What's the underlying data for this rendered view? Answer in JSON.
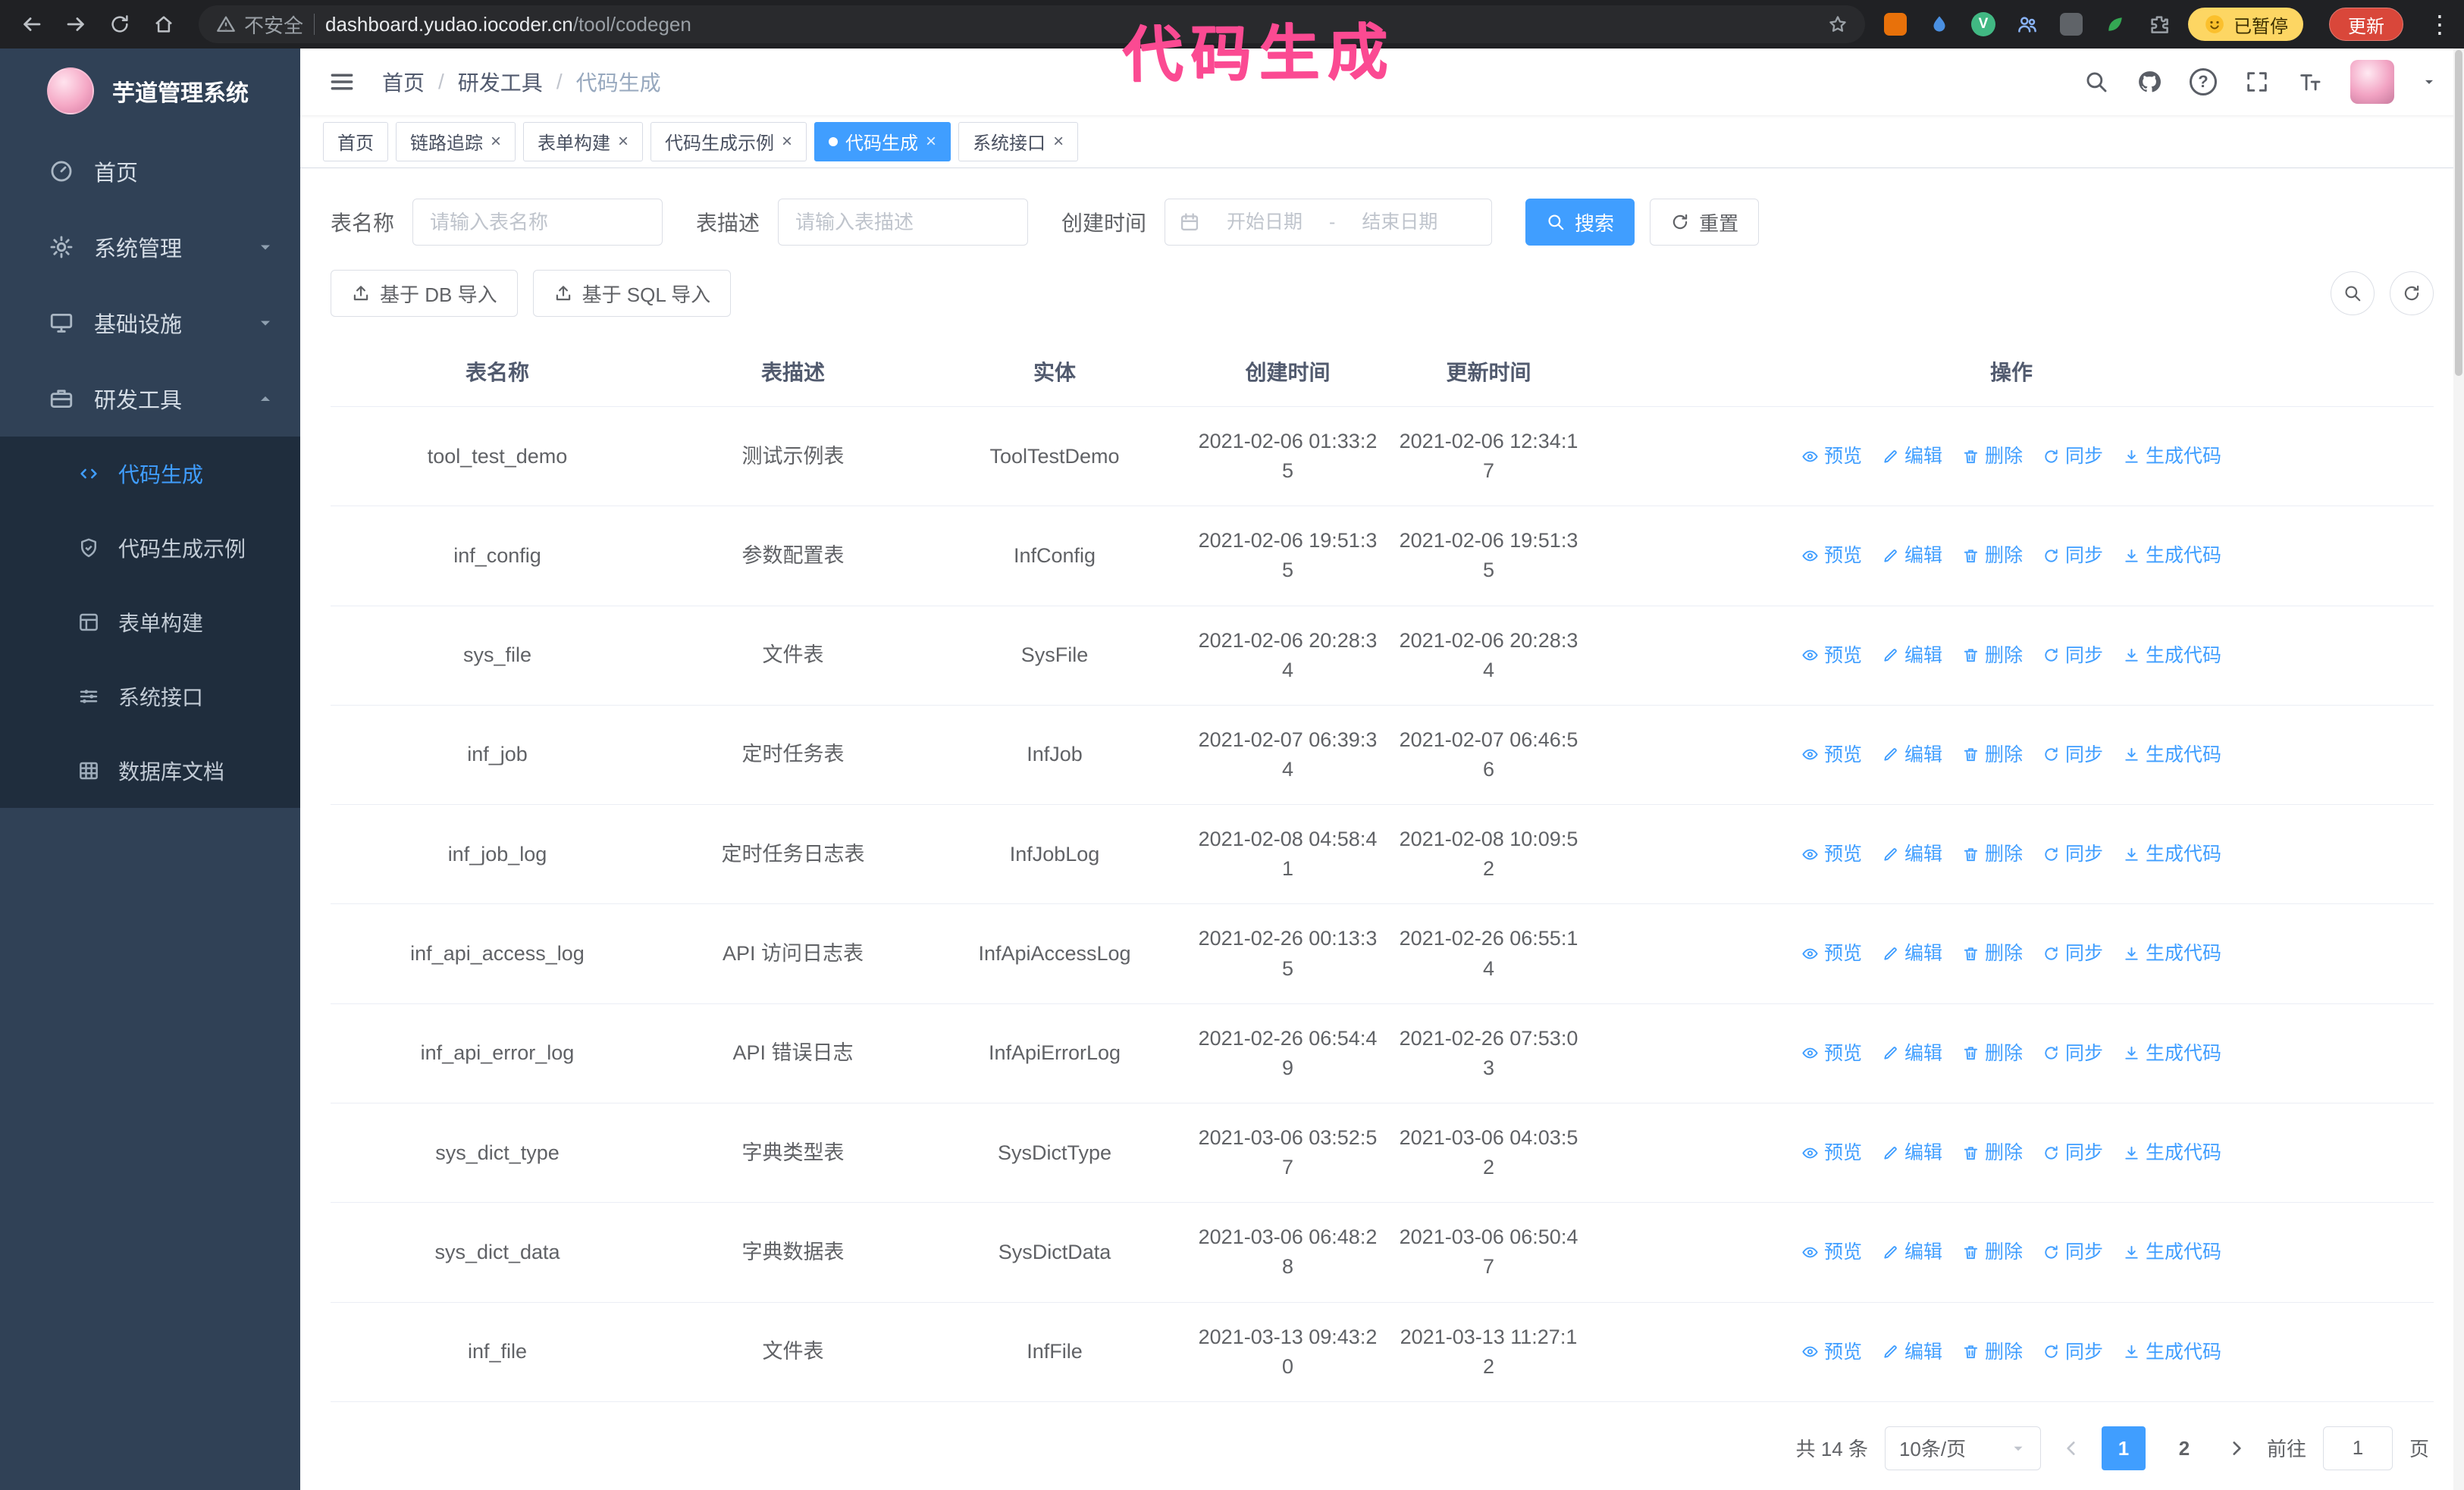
{
  "annotation": {
    "text": "代码生成",
    "color": "#fb4a92"
  },
  "icons": {
    "close": "×",
    "question": "?",
    "more_vertical": "⋮",
    "vue_badge": "V"
  },
  "browser": {
    "security_warning": "不安全",
    "url_domain": "dashboard.yudao.iocoder.cn",
    "url_path": "/tool/codegen",
    "paused_badge": "已暂停",
    "update_button": "更新"
  },
  "sidebar": {
    "logo_title": "芋道管理系统",
    "items": [
      {
        "label": "首页"
      },
      {
        "label": "系统管理"
      },
      {
        "label": "基础设施"
      },
      {
        "label": "研发工具"
      }
    ],
    "submenu": [
      {
        "label": "代码生成"
      },
      {
        "label": "代码生成示例"
      },
      {
        "label": "表单构建"
      },
      {
        "label": "系统接口"
      },
      {
        "label": "数据库文档"
      }
    ]
  },
  "navbar": {
    "breadcrumb": [
      "首页",
      "研发工具",
      "代码生成"
    ],
    "separator": "/"
  },
  "tabs": [
    {
      "label": "首页"
    },
    {
      "label": "链路追踪"
    },
    {
      "label": "表单构建"
    },
    {
      "label": "代码生成示例"
    },
    {
      "label": "代码生成"
    },
    {
      "label": "系统接口"
    }
  ],
  "filters": {
    "table_name_label": "表名称",
    "table_name_placeholder": "请输入表名称",
    "table_desc_label": "表描述",
    "table_desc_placeholder": "请输入表描述",
    "create_time_label": "创建时间",
    "date_start_placeholder": "开始日期",
    "date_separator": "-",
    "date_end_placeholder": "结束日期",
    "search_label": "搜索",
    "reset_label": "重置"
  },
  "toolbar": {
    "import_db": "基于 DB 导入",
    "import_sql": "基于 SQL 导入"
  },
  "table": {
    "headers": [
      "表名称",
      "表描述",
      "实体",
      "创建时间",
      "更新时间",
      "操作"
    ],
    "actions": [
      "预览",
      "编辑",
      "删除",
      "同步",
      "生成代码"
    ],
    "rows": [
      {
        "name": "tool_test_demo",
        "desc": "测试示例表",
        "entity": "ToolTestDemo",
        "created": "2021-02-06 01:33:25",
        "updated": "2021-02-06 12:34:17"
      },
      {
        "name": "inf_config",
        "desc": "参数配置表",
        "entity": "InfConfig",
        "created": "2021-02-06 19:51:35",
        "updated": "2021-02-06 19:51:35"
      },
      {
        "name": "sys_file",
        "desc": "文件表",
        "entity": "SysFile",
        "created": "2021-02-06 20:28:34",
        "updated": "2021-02-06 20:28:34"
      },
      {
        "name": "inf_job",
        "desc": "定时任务表",
        "entity": "InfJob",
        "created": "2021-02-07 06:39:34",
        "updated": "2021-02-07 06:46:56"
      },
      {
        "name": "inf_job_log",
        "desc": "定时任务日志表",
        "entity": "InfJobLog",
        "created": "2021-02-08 04:58:41",
        "updated": "2021-02-08 10:09:52"
      },
      {
        "name": "inf_api_access_log",
        "desc": "API 访问日志表",
        "entity": "InfApiAccessLog",
        "created": "2021-02-26 00:13:35",
        "updated": "2021-02-26 06:55:14"
      },
      {
        "name": "inf_api_error_log",
        "desc": "API 错误日志",
        "entity": "InfApiErrorLog",
        "created": "2021-02-26 06:54:49",
        "updated": "2021-02-26 07:53:03"
      },
      {
        "name": "sys_dict_type",
        "desc": "字典类型表",
        "entity": "SysDictType",
        "created": "2021-03-06 03:52:57",
        "updated": "2021-03-06 04:03:52"
      },
      {
        "name": "sys_dict_data",
        "desc": "字典数据表",
        "entity": "SysDictData",
        "created": "2021-03-06 06:48:28",
        "updated": "2021-03-06 06:50:47"
      },
      {
        "name": "inf_file",
        "desc": "文件表",
        "entity": "InfFile",
        "created": "2021-03-13 09:43:20",
        "updated": "2021-03-13 11:27:12"
      }
    ]
  },
  "pagination": {
    "total": "共 14 条",
    "page_size": "10条/页",
    "pages": [
      "1",
      "2"
    ],
    "goto_label": "前往",
    "goto_value": "1",
    "unit": "页"
  },
  "colors": {
    "primary": "#409eff",
    "sidebar": "#304156",
    "sidebar_dark": "#1f2d3d"
  }
}
